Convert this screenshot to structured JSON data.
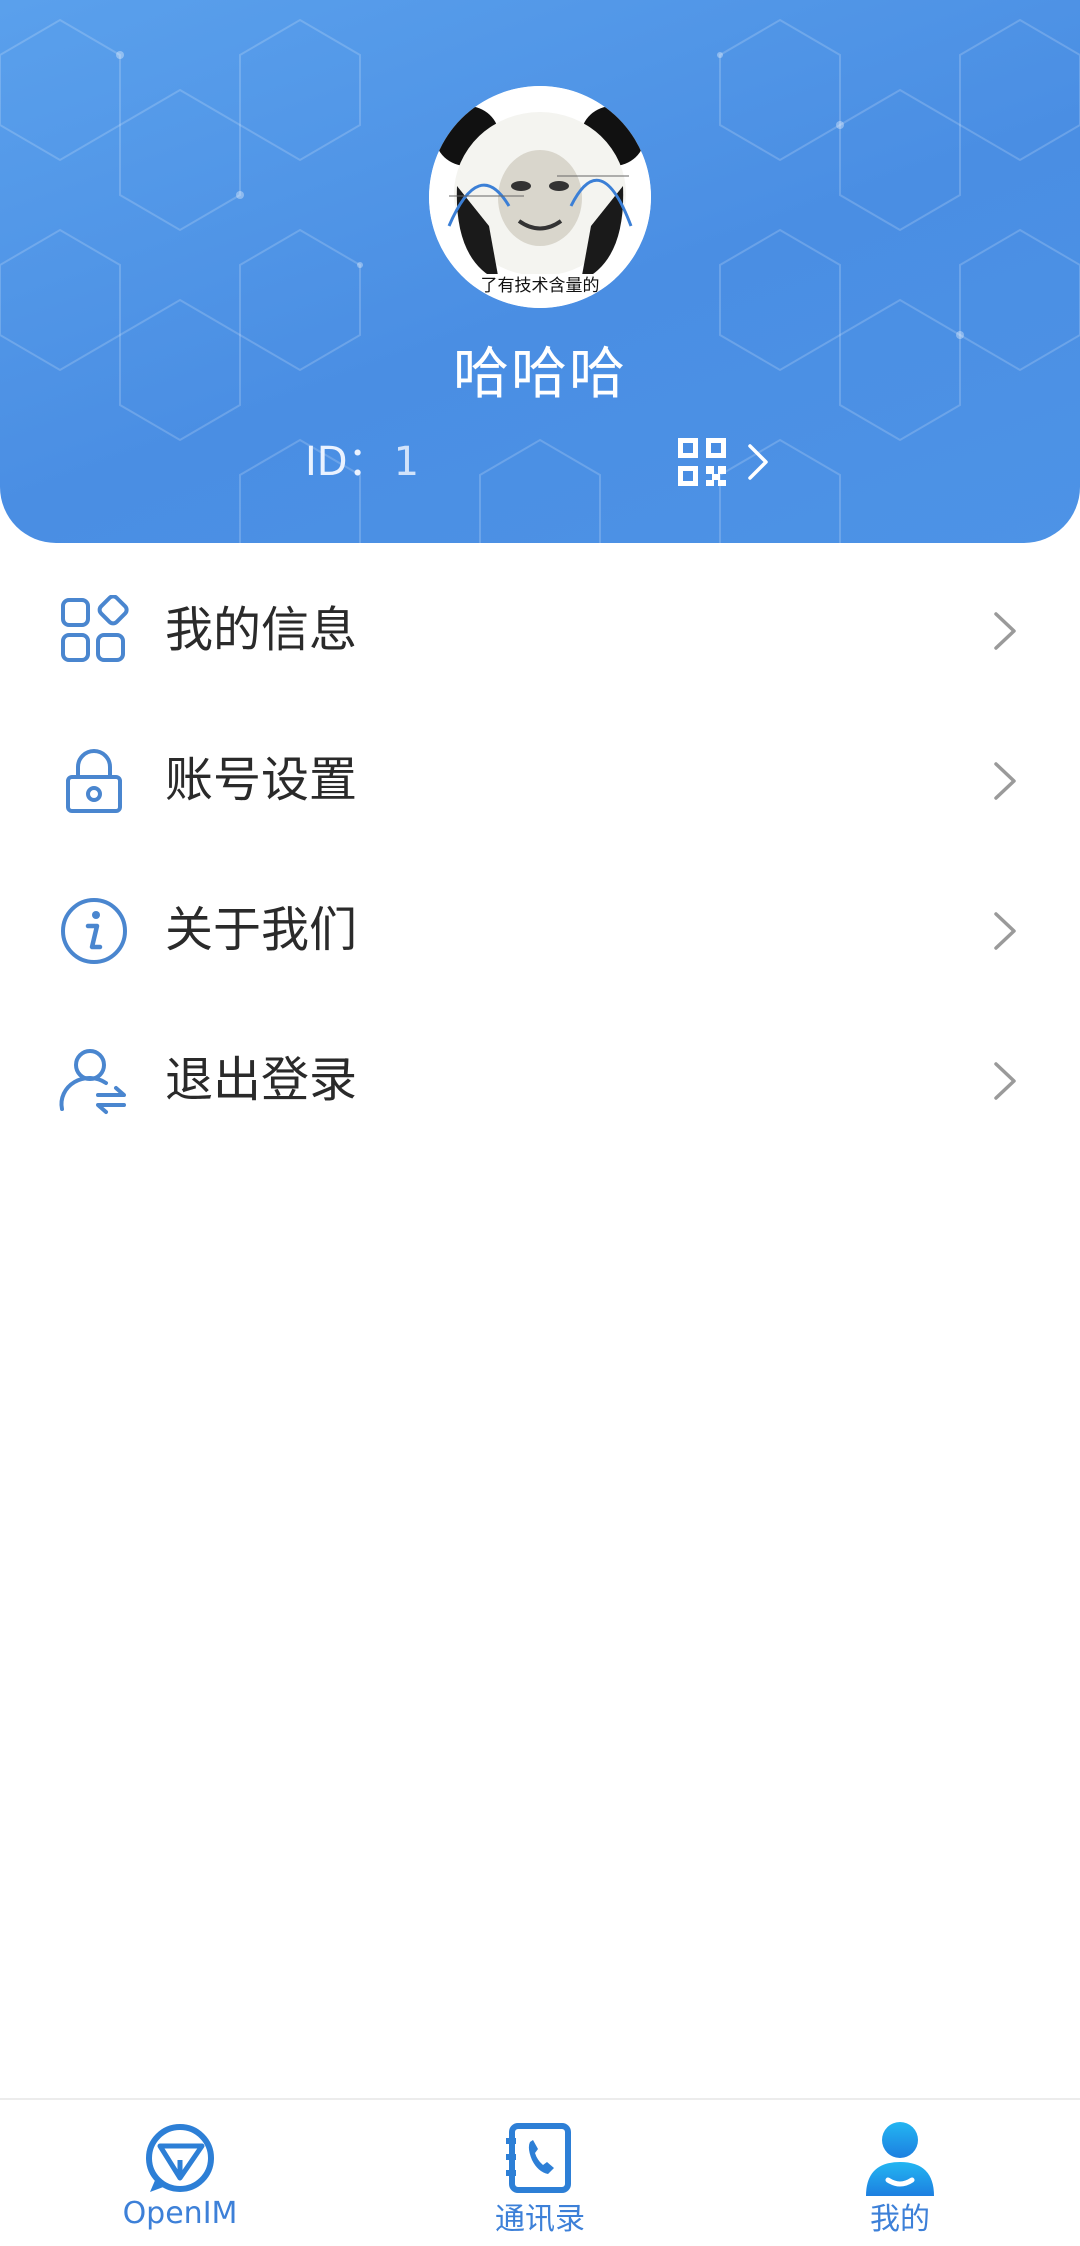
{
  "colors": {
    "brand_blue": "#4a8ee3",
    "icon_blue": "#4a86cf",
    "text_dark": "#2a2a2a",
    "arrow_gray": "#9a9a9a",
    "tab_active": "#1f8fe6"
  },
  "profile": {
    "avatar_icon": "panda-meme-avatar",
    "avatar_caption": "了有技术含量的",
    "nickname": "哈哈哈",
    "id_label": "ID：",
    "id_value": "1",
    "qr_icon": "qr-code-icon"
  },
  "menu": {
    "items": [
      {
        "label": "我的信息",
        "icon": "apps-grid-icon"
      },
      {
        "label": "账号设置",
        "icon": "lock-icon"
      },
      {
        "label": "关于我们",
        "icon": "info-icon"
      },
      {
        "label": "退出登录",
        "icon": "user-switch-icon"
      }
    ]
  },
  "tabbar": {
    "tabs": [
      {
        "label": "OpenIM",
        "icon": "openim-logo-icon",
        "active": false
      },
      {
        "label": "通讯录",
        "icon": "contacts-book-icon",
        "active": false
      },
      {
        "label": "我的",
        "icon": "person-icon",
        "active": true
      }
    ]
  }
}
